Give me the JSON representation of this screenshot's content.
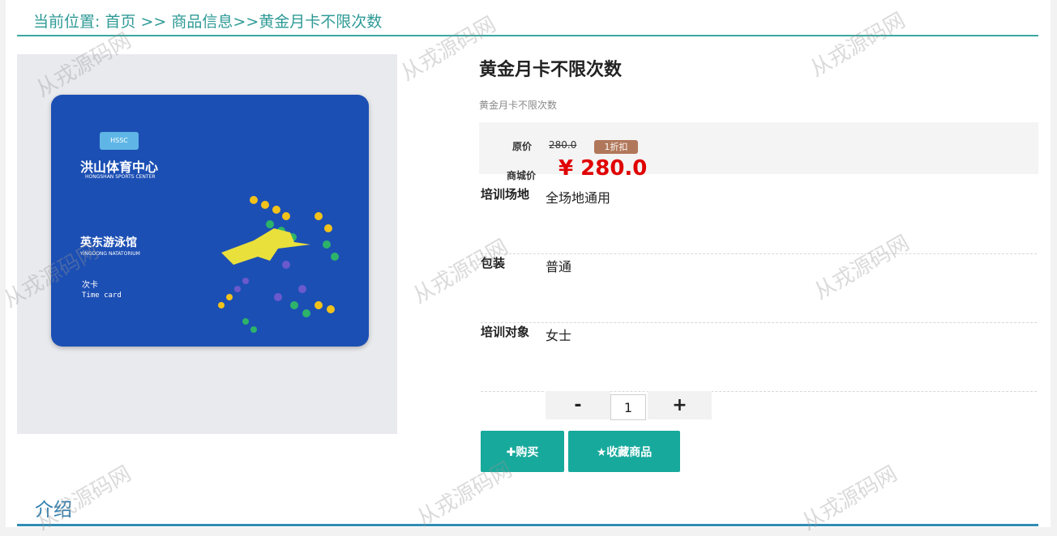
{
  "breadcrumb": {
    "prefix": "当前位置: ",
    "home": "首页",
    "sep1": " >> ",
    "category": "商品信息",
    "sep2": ">>",
    "current": "黄金月卡不限次数"
  },
  "product": {
    "image_alt": "黄金月卡不限次数",
    "card": {
      "badge": "HSSC",
      "name_cn": "洪山体育中心",
      "name_en": "HONGSHAN SPORTS CENTER",
      "venue_cn": "英东游泳馆",
      "venue_en": "YINGDONG NATATORIUM",
      "type_cn": "次卡",
      "type_en": "Time card"
    },
    "title": "黄金月卡不限次数",
    "subtitle": "黄金月卡不限次数",
    "price": {
      "original_label": "原价",
      "original_value": "280.0",
      "discount_badge": "1折扣",
      "mall_label": "商城价",
      "mall_value": "¥ 280.0"
    },
    "attributes": [
      {
        "key": "培训场地",
        "value": "全场地通用"
      },
      {
        "key": "包装",
        "value": "普通"
      },
      {
        "key": "培训对象",
        "value": "女士"
      }
    ],
    "quantity": {
      "minus_label": "-",
      "value": "1",
      "plus_label": "+"
    },
    "buttons": {
      "buy": "✚购买",
      "favorite": "★收藏商品"
    }
  },
  "section": {
    "intro_title": "介绍"
  },
  "watermark": "从戎源码网",
  "colors": {
    "accent_teal": "#17a99c",
    "breadcrumb_teal": "#2e9a96",
    "price_red": "#e00000",
    "discount_brown": "#b1775a",
    "intro_blue": "#2f8db3"
  }
}
